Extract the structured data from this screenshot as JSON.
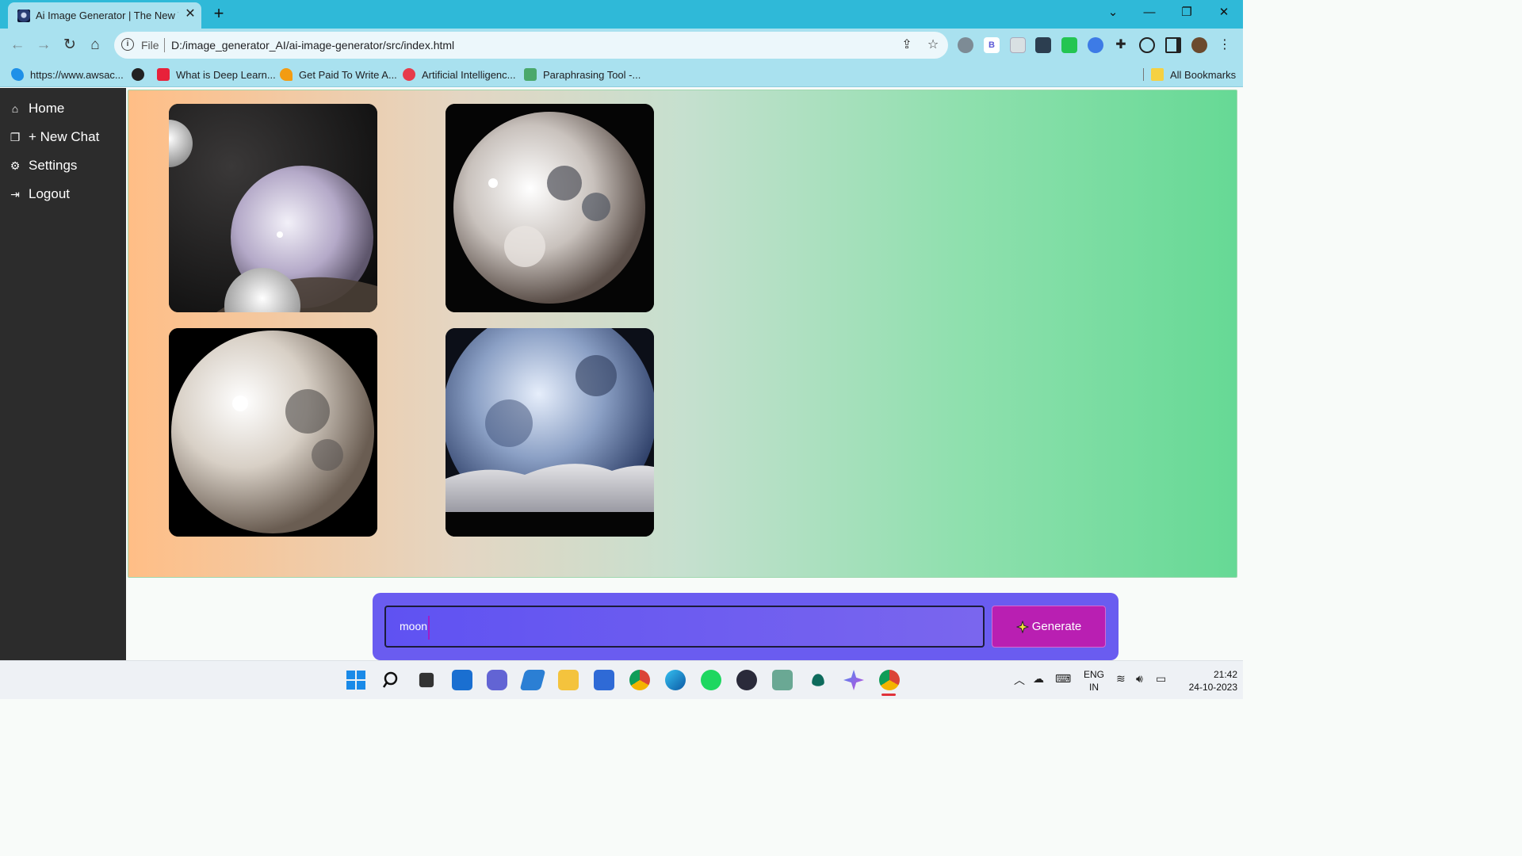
{
  "browser": {
    "tab_title": "Ai Image Generator | The New W",
    "tab_close": "✕",
    "new_tab": "+",
    "window_controls": [
      "⌄",
      "—",
      "❐",
      "✕"
    ],
    "nav": {
      "back": "←",
      "forward": "→",
      "reload": "↻",
      "home": "⌂"
    },
    "address": {
      "scheme_label": "File",
      "url": "D:/image_generator_AI/ai-image-generator/src/index.html"
    },
    "ext_b_label": "B",
    "bookmarks": [
      {
        "label": "https://www.awsac..."
      },
      {
        "label": ""
      },
      {
        "label": "What is Deep Learn..."
      },
      {
        "label": "Get Paid To Write A..."
      },
      {
        "label": "Artificial Intelligenc..."
      },
      {
        "label": "Paraphrasing Tool -..."
      }
    ],
    "all_bookmarks": "All Bookmarks"
  },
  "sidebar": {
    "items": [
      {
        "label": "Home",
        "icon": "home-icon"
      },
      {
        "label": "+ New Chat",
        "icon": "chat-icon"
      },
      {
        "label": "Settings",
        "icon": "gear-icon"
      },
      {
        "label": "Logout",
        "icon": "logout-icon"
      }
    ]
  },
  "gallery": {
    "images": [
      {
        "alt": "moon image 1"
      },
      {
        "alt": "moon image 2"
      },
      {
        "alt": "moon image 3"
      },
      {
        "alt": "moon image 4"
      }
    ]
  },
  "prompt": {
    "value": "moon",
    "generate_label": "Generate",
    "generate_icon": "sparkle-icon"
  },
  "taskbar": {
    "lang_line1": "ENG",
    "lang_line2": "IN",
    "time": "21:42",
    "date": "24-10-2023"
  },
  "colors": {
    "sidebar_bg": "#2c2c2c",
    "prompt_panel": "#6a5cf0",
    "generate_button": "#b91fb2",
    "browser_chrome": "#2fb9d8"
  }
}
